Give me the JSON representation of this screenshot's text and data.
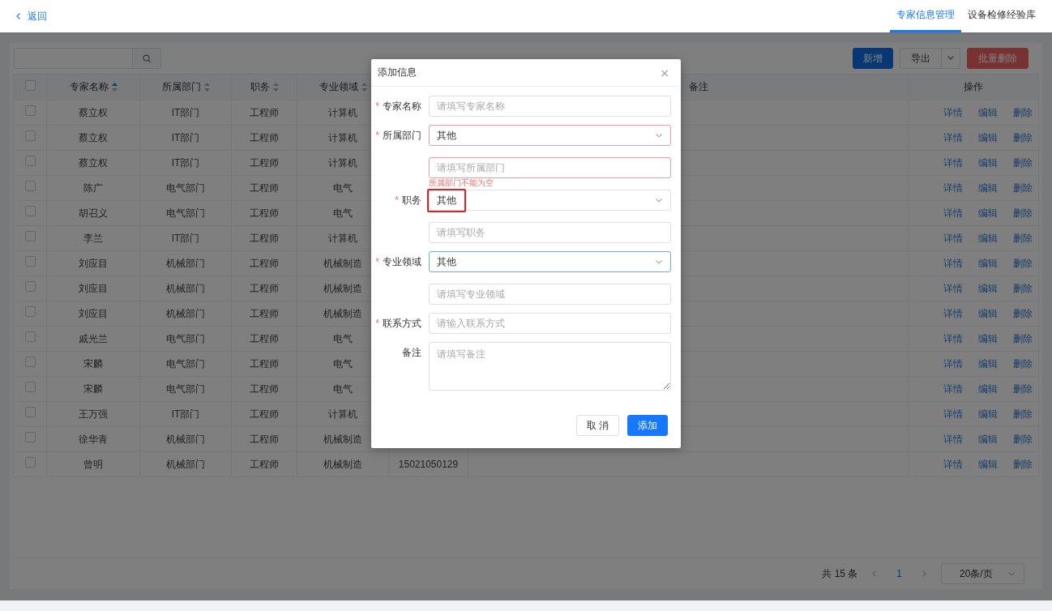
{
  "header": {
    "back": "返回",
    "tabs": [
      {
        "label": "专家信息管理",
        "selected": true
      },
      {
        "label": "设备检修经验库",
        "selected": false
      }
    ]
  },
  "toolbar": {
    "buttons": [
      {
        "label": "新增",
        "kind": "primary"
      },
      {
        "label": "导出",
        "kind": "split"
      },
      {
        "label": "批量删除",
        "kind": "danger"
      }
    ]
  },
  "table": {
    "all_checked": false,
    "columns": [
      {
        "label": "专家名称",
        "sortable": true,
        "sorted": true
      },
      {
        "label": "所属部门",
        "sortable": true,
        "sorted": false
      },
      {
        "label": "职务",
        "sortable": true,
        "sorted": false
      },
      {
        "label": "专业领域",
        "sortable": true,
        "sorted": false
      },
      {
        "label": "备注"
      },
      {
        "label": "操作"
      }
    ],
    "rows": [
      {
        "checked": false,
        "name": "蔡立权",
        "dept": "IT部门",
        "title": "工程师",
        "field": "计算机",
        "actions": [
          "详情",
          "编辑",
          "删除"
        ]
      },
      {
        "checked": false,
        "name": "蔡立权",
        "dept": "IT部门",
        "title": "工程师",
        "field": "计算机",
        "actions": [
          "详情",
          "编辑",
          "删除"
        ]
      },
      {
        "checked": false,
        "name": "蔡立权",
        "dept": "IT部门",
        "title": "工程师",
        "field": "计算机",
        "actions": [
          "详情",
          "编辑",
          "删除"
        ]
      },
      {
        "checked": false,
        "name": "陈广",
        "dept": "电气部门",
        "title": "工程师",
        "field": "电气",
        "actions": [
          "详情",
          "编辑",
          "删除"
        ]
      },
      {
        "checked": false,
        "name": "胡召义",
        "dept": "电气部门",
        "title": "工程师",
        "field": "电气",
        "actions": [
          "详情",
          "编辑",
          "删除"
        ]
      },
      {
        "checked": false,
        "name": "李兰",
        "dept": "IT部门",
        "title": "工程师",
        "field": "计算机",
        "actions": [
          "详情",
          "编辑",
          "删除"
        ]
      },
      {
        "checked": false,
        "name": "刘应目",
        "dept": "机械部门",
        "title": "工程师",
        "field": "机械制造",
        "actions": [
          "详情",
          "编辑",
          "删除"
        ]
      },
      {
        "checked": false,
        "name": "刘应目",
        "dept": "机械部门",
        "title": "工程师",
        "field": "机械制造",
        "actions": [
          "详情",
          "编辑",
          "删除"
        ]
      },
      {
        "checked": false,
        "name": "刘应目",
        "dept": "机械部门",
        "title": "工程师",
        "field": "机械制造",
        "actions": [
          "详情",
          "编辑",
          "删除"
        ]
      },
      {
        "checked": false,
        "name": "戚光兰",
        "dept": "电气部门",
        "title": "工程师",
        "field": "电气",
        "actions": [
          "详情",
          "编辑",
          "删除"
        ]
      },
      {
        "checked": false,
        "name": "宋麟",
        "dept": "电气部门",
        "title": "工程师",
        "field": "电气",
        "actions": [
          "详情",
          "编辑",
          "删除"
        ]
      },
      {
        "checked": false,
        "name": "宋麟",
        "dept": "电气部门",
        "title": "工程师",
        "field": "电气",
        "actions": [
          "详情",
          "编辑",
          "删除"
        ]
      },
      {
        "checked": false,
        "name": "王万强",
        "dept": "IT部门",
        "title": "工程师",
        "field": "计算机",
        "actions": [
          "详情",
          "编辑",
          "删除"
        ]
      },
      {
        "checked": false,
        "name": "徐华青",
        "dept": "机械部门",
        "title": "工程师",
        "field": "机械制造",
        "actions": [
          "详情",
          "编辑",
          "删除"
        ]
      },
      {
        "checked": false,
        "name": "曾明",
        "dept": "机械部门",
        "title": "工程师",
        "field": "机械制造",
        "column_6": "15021050129",
        "actions": [
          "详情",
          "编辑",
          "删除"
        ]
      }
    ]
  },
  "pagination": {
    "total": "共 15 条",
    "pages": [
      {
        "label": "1",
        "selected": true
      }
    ],
    "page_size": "20条/页"
  },
  "dialog": {
    "title": "添加信息",
    "close": "×",
    "fields": [
      {
        "kind": "input",
        "label": "专家名称",
        "required_mark": "*",
        "placeholder": "请填写专家名称",
        "invalid": false,
        "focused": false
      },
      {
        "kind": "select",
        "label": "所属部门",
        "required_mark": "*",
        "value": "其他",
        "invalid": true,
        "focused": false,
        "highlighted": false
      },
      {
        "kind": "input",
        "placeholder": "请填写所属部门",
        "invalid": true,
        "focused": false,
        "error": "所属部门不能为空"
      },
      {
        "kind": "select",
        "label": "职务",
        "required_mark": "*",
        "value": "其他",
        "invalid": false,
        "focused": false,
        "highlighted": true
      },
      {
        "kind": "input",
        "placeholder": "请填写职务",
        "invalid": false,
        "focused": false
      },
      {
        "kind": "select",
        "label": "专业领域",
        "required_mark": "*",
        "value": "其他",
        "invalid": false,
        "focused": true,
        "highlighted": false
      },
      {
        "kind": "input",
        "placeholder": "请填写专业领域",
        "invalid": false,
        "focused": false
      },
      {
        "kind": "input",
        "label": "联系方式",
        "required_mark": "*",
        "placeholder": "请输入联系方式",
        "invalid": false,
        "focused": false
      },
      {
        "kind": "textarea",
        "label": "备注",
        "placeholder": "请填写备注",
        "invalid": false,
        "focused": false
      }
    ],
    "buttons": [
      {
        "label": "取 消",
        "kind": "default"
      },
      {
        "label": "添加",
        "kind": "primary"
      }
    ]
  }
}
